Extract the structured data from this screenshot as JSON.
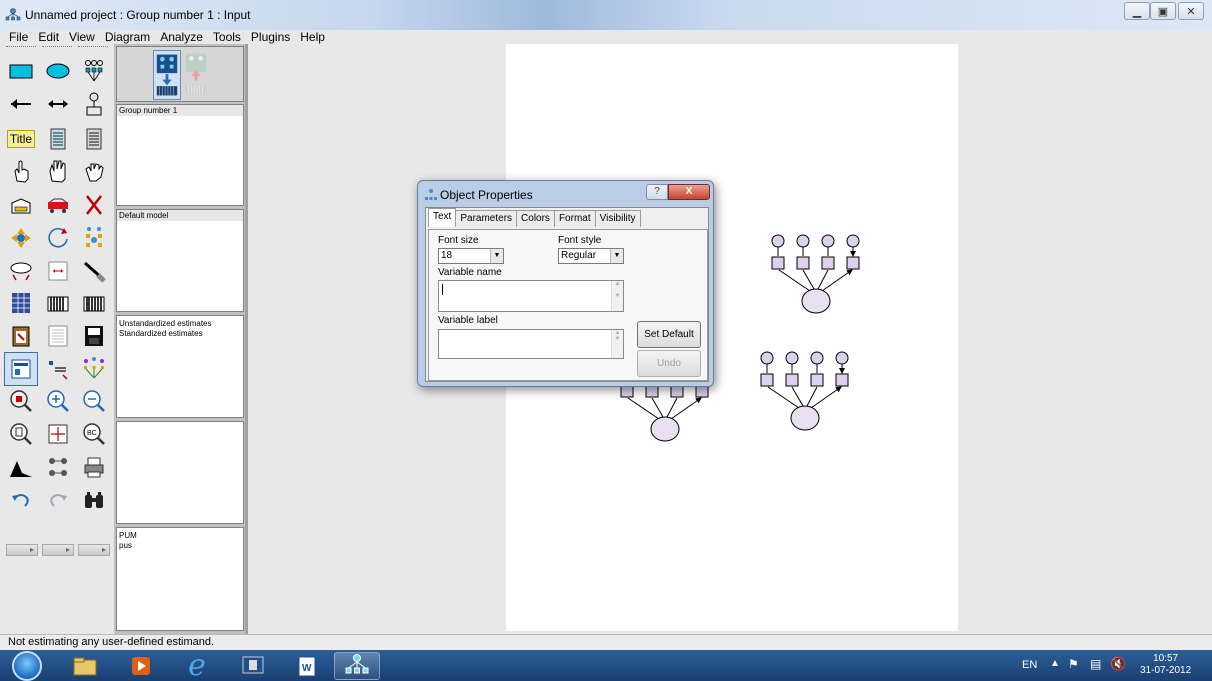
{
  "window": {
    "title": "Unnamed project : Group number 1 : Input",
    "controls": [
      "minimize",
      "maximize",
      "close"
    ]
  },
  "menu": [
    "File",
    "Edit",
    "View",
    "Diagram",
    "Analyze",
    "Tools",
    "Plugins",
    "Help"
  ],
  "tools": [
    "rectangle-icon",
    "ellipse-icon",
    "indicator-icon",
    "single-arrow-icon",
    "double-arrow-icon",
    "unique-variable-icon",
    "title-icon",
    "list-variables-model-icon",
    "list-variables-dataset-icon",
    "select-one-icon",
    "select-all-icon",
    "deselect-all-icon",
    "duplicate-icon",
    "move-icon",
    "erase-icon",
    "move-parameter-icon",
    "rotate-icon",
    "reflect-icon",
    "shape-change-icon",
    "scroll-icon",
    "touch-up-icon",
    "data-files-icon",
    "analysis-properties-icon",
    "calculate-estimates-icon",
    "copy-to-clipboard-icon",
    "text-output-icon",
    "save-icon",
    "object-properties-icon",
    "drag-properties-icon",
    "preserve-symmetries-icon",
    "zoom-in-area-icon",
    "zoom-in-icon",
    "zoom-out-icon",
    "zoom-page-icon",
    "fit-to-page-icon",
    "loupe-icon",
    "bayesian-icon",
    "multiple-group-icon",
    "print-icon",
    "undo-icon",
    "redo-icon",
    "specification-search-icon"
  ],
  "title_tool_label": "Title",
  "panels": {
    "groups": {
      "items": [
        "Group number 1"
      ]
    },
    "models": {
      "items": [
        "Default model"
      ]
    },
    "estimates": {
      "items": [
        "Unstandardized estimates",
        "Standardized estimates"
      ]
    },
    "empty": {
      "items": []
    },
    "files": {
      "items": [
        "PUM",
        "pus"
      ]
    }
  },
  "status": "Not estimating any user-defined estimand.",
  "dialog": {
    "title": "Object Properties",
    "help": "?",
    "close": "X",
    "tabs": [
      "Text",
      "Parameters",
      "Colors",
      "Format",
      "Visibility"
    ],
    "selected_tab": "Text",
    "font_size_label": "Font size",
    "font_size_value": "18",
    "font_style_label": "Font style",
    "font_style_value": "Regular",
    "variable_name_label": "Variable name",
    "variable_name_value": "",
    "variable_label_label": "Variable label",
    "variable_label_value": "",
    "set_default_label": "Set Default",
    "undo_label": "Undo"
  },
  "taskbar": {
    "apps": [
      "explorer-icon",
      "media-player-icon",
      "internet-explorer-icon",
      "desktop-icon",
      "word-icon",
      "amos-icon"
    ],
    "active_app": "amos-icon",
    "language": "EN",
    "time": "10:57",
    "date": "31-07-2012"
  },
  "colors": {
    "rect_fill": "#00c0e0",
    "ellipse_fill": "#00c0e0",
    "latent_fill": "#e8e0f0",
    "observed_fill": "#ddd0ec",
    "taskbar": "#1e4a82",
    "dialog_frame": "#b9cde6"
  }
}
